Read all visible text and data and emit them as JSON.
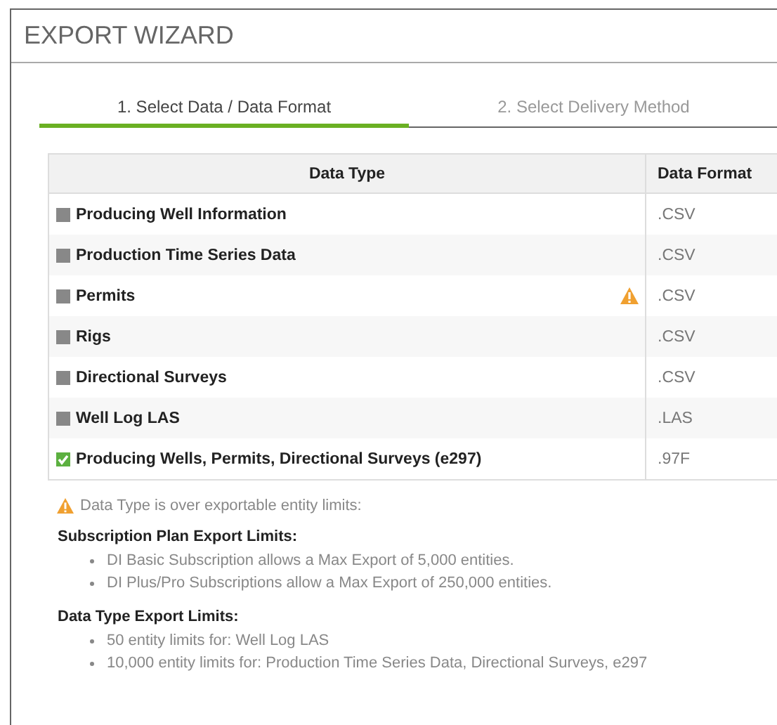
{
  "window": {
    "title": "EXPORT WIZARD"
  },
  "tabs": [
    {
      "label": "1. Select Data / Data Format",
      "selected": true
    },
    {
      "label": "2. Select Delivery Method",
      "selected": false
    }
  ],
  "table": {
    "columns": [
      "Data Type",
      "Data Format"
    ],
    "rows": [
      {
        "name": "Producing Well Information",
        "format": ".CSV",
        "checked": false,
        "warning": false
      },
      {
        "name": "Production Time Series Data",
        "format": ".CSV",
        "checked": false,
        "warning": false
      },
      {
        "name": "Permits",
        "format": ".CSV",
        "checked": false,
        "warning": true
      },
      {
        "name": "Rigs",
        "format": ".CSV",
        "checked": false,
        "warning": false
      },
      {
        "name": "Directional Surveys",
        "format": ".CSV",
        "checked": false,
        "warning": false
      },
      {
        "name": "Well Log LAS",
        "format": ".LAS",
        "checked": false,
        "warning": false
      },
      {
        "name": "Producing Wells, Permits, Directional Surveys (e297)",
        "format": ".97F",
        "checked": true,
        "warning": false
      }
    ]
  },
  "warning_note": "Data Type is over exportable entity limits:",
  "sections": [
    {
      "heading": "Subscription Plan Export Limits:",
      "items": [
        "DI Basic Subscription allows a Max Export of 5,000 entities.",
        "DI Plus/Pro Subscriptions allow a Max Export of 250,000 entities."
      ]
    },
    {
      "heading": "Data Type Export Limits:",
      "items": [
        "50 entity limits for: Well Log LAS",
        "10,000 entity limits for: Production Time Series Data, Directional Surveys, e297"
      ]
    }
  ]
}
